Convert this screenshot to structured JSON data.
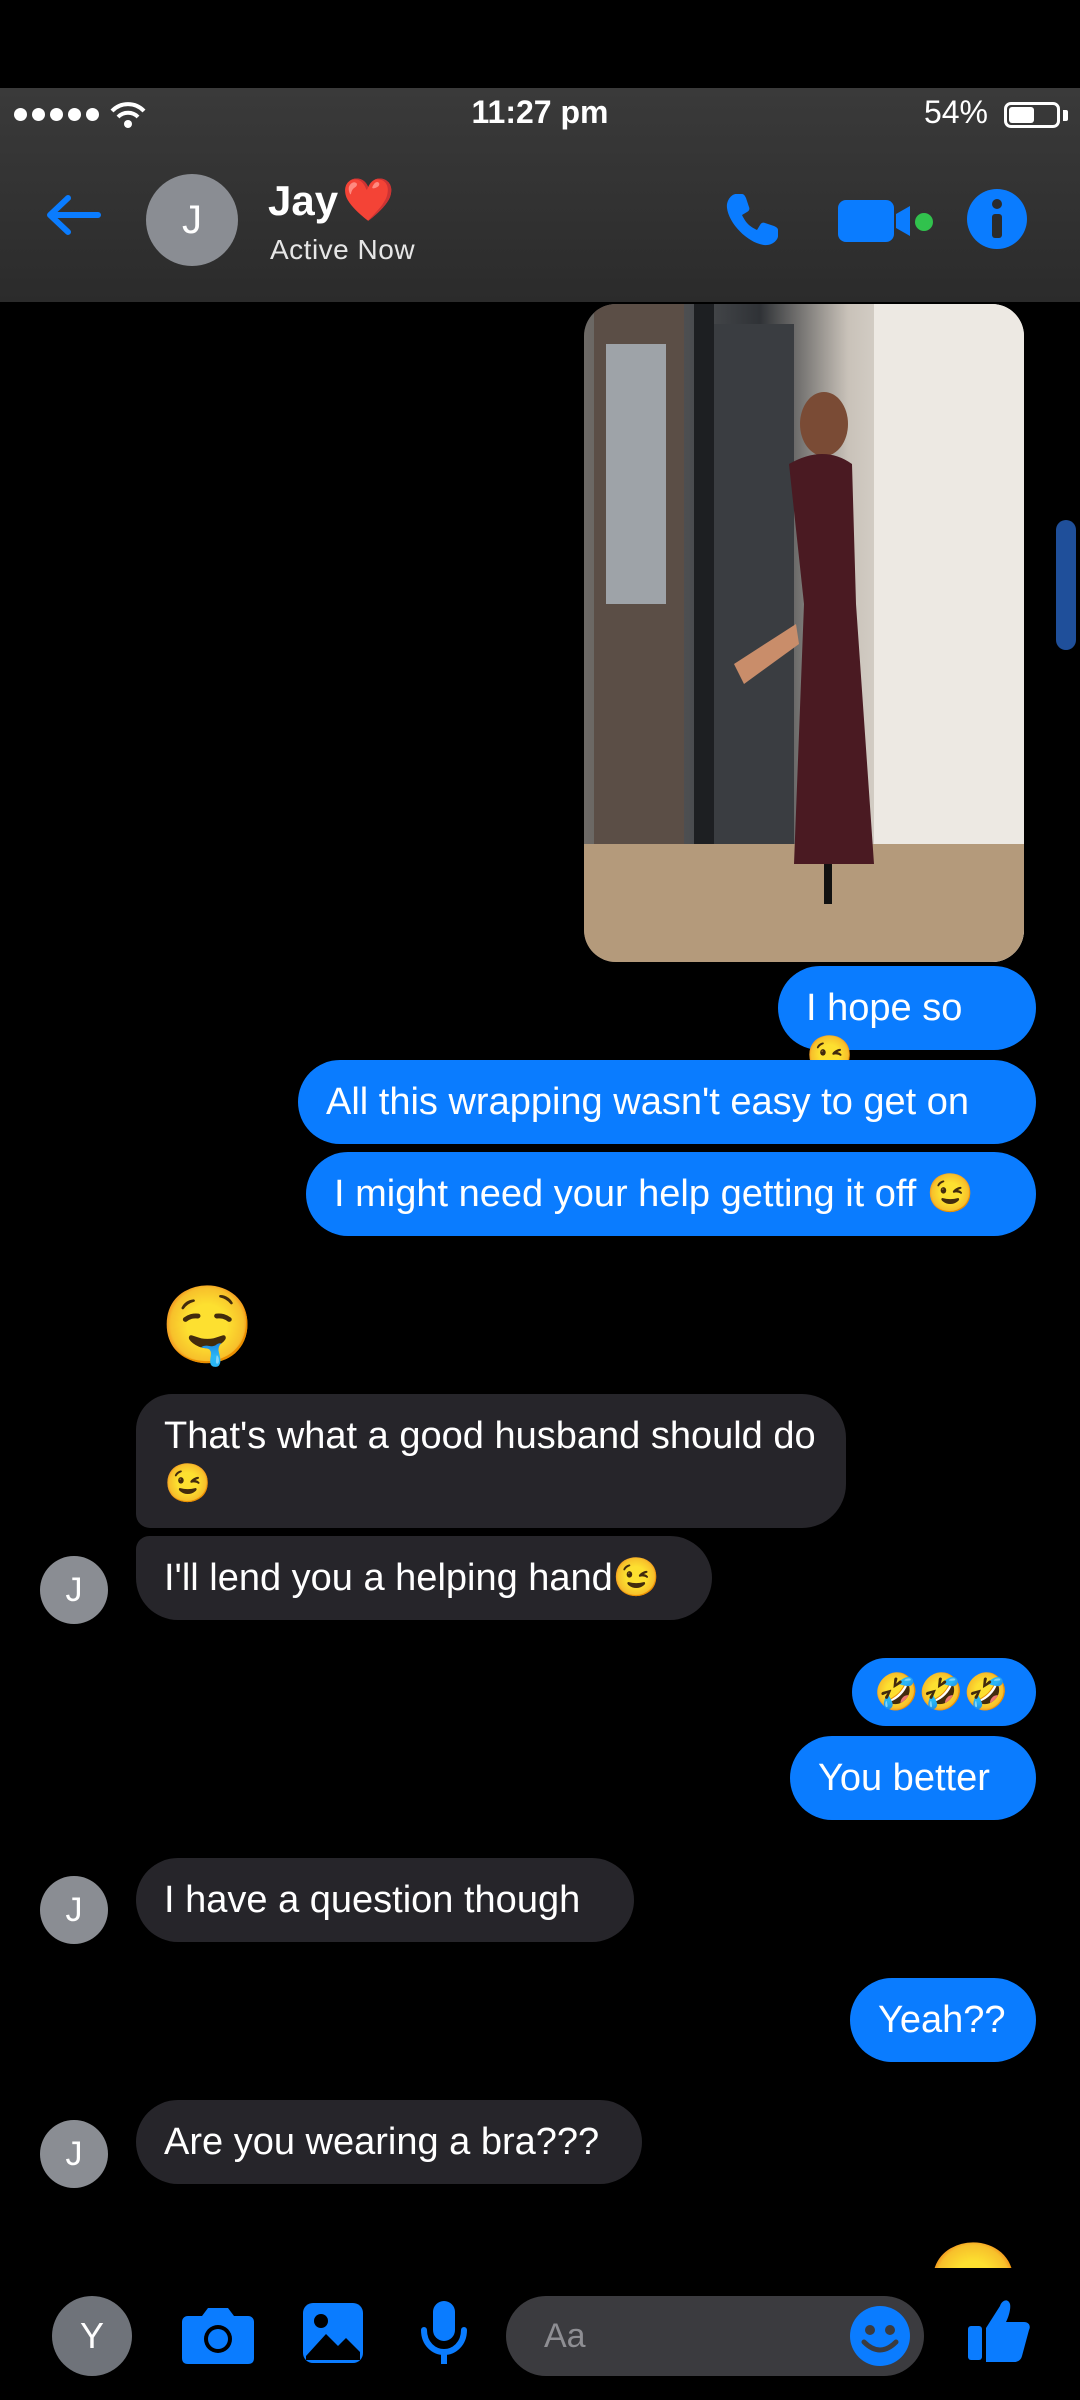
{
  "status_bar": {
    "time": "11:27 pm",
    "battery": "54%",
    "battery_level": 0.54
  },
  "header": {
    "contact_initial": "J",
    "contact_name": "Jay",
    "contact_emoji": "❤️",
    "status": "Active Now"
  },
  "colors": {
    "accent": "#0a7cff",
    "incoming_bubble": "#26252a",
    "active_dot": "#31c24d"
  },
  "messages": [
    {
      "dir": "out",
      "text": "I hope so😉"
    },
    {
      "dir": "out",
      "text": "All this wrapping wasn't easy to get on"
    },
    {
      "dir": "out",
      "text": "I might need your help getting it off 😉"
    },
    {
      "dir": "in",
      "text": "🤤"
    },
    {
      "dir": "in",
      "text": "That's what a good husband should do😉"
    },
    {
      "dir": "in",
      "text": "I'll lend you a helping hand😉",
      "avatar": "J"
    },
    {
      "dir": "out",
      "text": "🤣🤣🤣"
    },
    {
      "dir": "out",
      "text": "You better"
    },
    {
      "dir": "in",
      "text": "I have a question though",
      "avatar": "J"
    },
    {
      "dir": "out",
      "text": "Yeah??"
    },
    {
      "dir": "in",
      "text": "Are you wearing a bra???",
      "avatar": "J"
    },
    {
      "dir": "out",
      "text": "😊"
    }
  ],
  "composer": {
    "user_initial": "Y",
    "placeholder": "Aa"
  },
  "icons": [
    "back-arrow-icon",
    "phone-icon",
    "video-icon",
    "info-icon",
    "camera-icon",
    "image-icon",
    "mic-icon",
    "emoji-icon",
    "like-icon"
  ]
}
